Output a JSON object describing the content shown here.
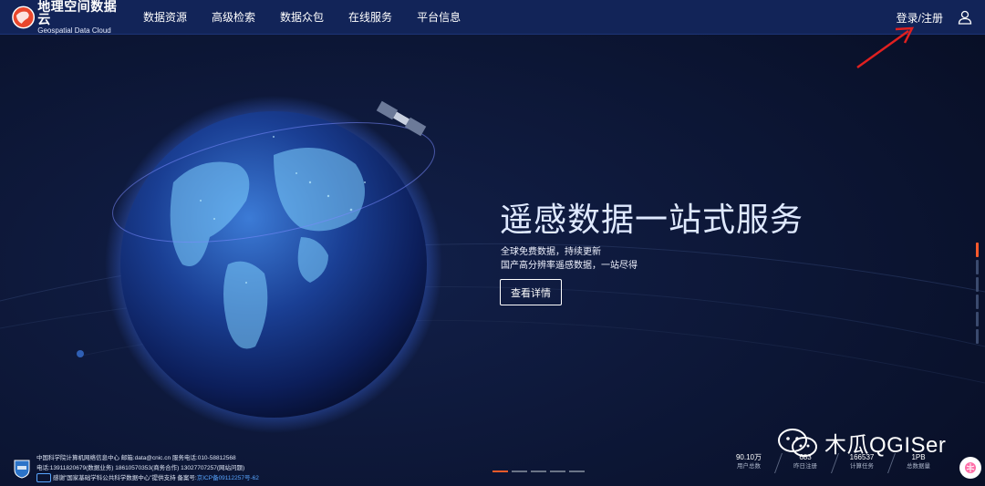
{
  "brand": {
    "name_cn": "地理空间数据云",
    "name_en": "Geospatial Data Cloud",
    "logo_icon": "globe-logo-icon",
    "accent": "#e9472c"
  },
  "nav": {
    "items": [
      {
        "label": "数据资源"
      },
      {
        "label": "高级检索"
      },
      {
        "label": "数据众包"
      },
      {
        "label": "在线服务"
      },
      {
        "label": "平台信息"
      }
    ],
    "auth_label": "登录/注册",
    "user_icon": "user-icon"
  },
  "hero": {
    "title": "遥感数据一站式服务",
    "subtitle_line1": "全球免费数据，持续更新",
    "subtitle_line2": "国产高分辨率遥感数据，一站尽得",
    "button_label": "查看详情",
    "background_color": "#0b1430"
  },
  "carousel": {
    "slide_count": 5,
    "active_index": 0,
    "active_color": "#f25a2a"
  },
  "side_indicator": {
    "count": 6,
    "active_index": 0
  },
  "footer": {
    "line1": "中国科学院计算机网络信息中心 邮箱:data@cnic.cn 服务电话:010-58812568",
    "line2": "电话:13911820679(数据业务) 18610570353(商务合作) 13027707257(网站问题)",
    "line3": "感谢\"国家基础学科公共科学数据中心\"提供支持 备案号:",
    "icp": "京ICP备09112257号-62"
  },
  "stats": [
    {
      "value": "90.10万",
      "label": "用户总数"
    },
    {
      "value": "683",
      "label": "昨日注册"
    },
    {
      "value": "166537",
      "label": "计算任务"
    },
    {
      "value": "1PB",
      "label": "总数据量"
    }
  ],
  "watermark": {
    "text": "木瓜QGISer",
    "icon": "wechat-icon"
  }
}
